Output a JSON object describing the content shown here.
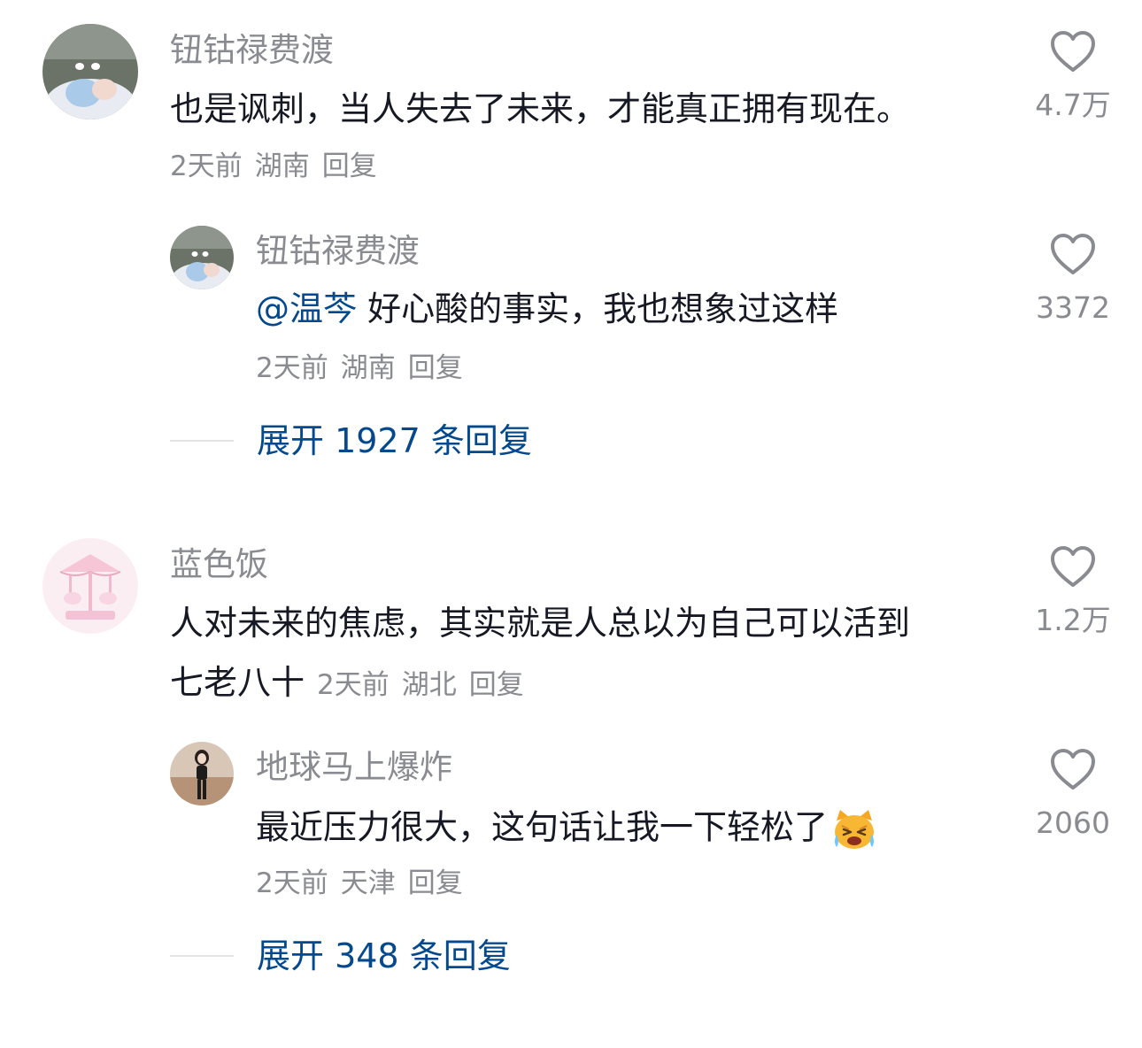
{
  "comments": [
    {
      "username": "钮钴禄费渡",
      "text": "也是讽刺，当人失去了未来，才能真正拥有现在。",
      "time": "2天前",
      "location": "湖南",
      "reply_label": "回复",
      "likes": "4.7万",
      "icons": {
        "like": "heart-icon"
      },
      "reply": {
        "username": "钮钴禄费渡",
        "mention": "@温芩",
        "text": "好心酸的事实，我也想象过这样",
        "time": "2天前",
        "location": "湖南",
        "reply_label": "回复",
        "likes": "3372"
      },
      "expand_label": "展开 1927 条回复"
    },
    {
      "username": "蓝色饭",
      "text_line1": "人对未来的焦虑，其实就是人总以为自己可以活到",
      "text_line2": "七老八十",
      "time": "2天前",
      "location": "湖北",
      "reply_label": "回复",
      "likes": "1.2万",
      "reply": {
        "username": "地球马上爆炸",
        "text": "最近压力很大，这句话让我一下轻松了",
        "emoji": "crying-cat-emoji",
        "time": "2天前",
        "location": "天津",
        "reply_label": "回复",
        "likes": "2060"
      },
      "expand_label": "展开 348 条回复"
    }
  ],
  "colors": {
    "text_primary": "#161823",
    "text_secondary": "#8a8b91",
    "link_blue": "#04498d"
  }
}
